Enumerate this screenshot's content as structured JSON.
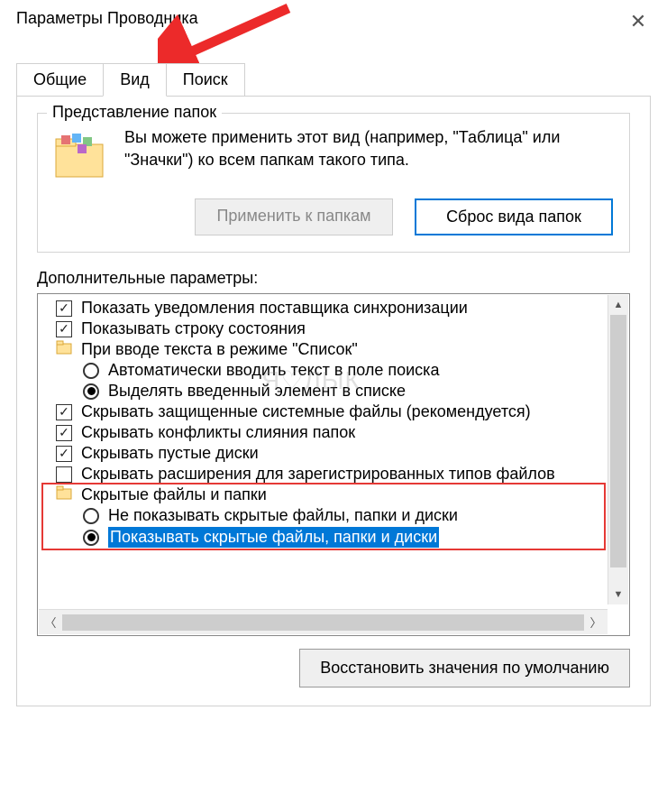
{
  "window": {
    "title": "Параметры Проводника",
    "close_symbol": "✕"
  },
  "tabs": {
    "general": "Общие",
    "view": "Вид",
    "search": "Поиск"
  },
  "folderViews": {
    "legend": "Представление папок",
    "description": "Вы можете применить этот вид (например, \"Таблица\" или \"Значки\") ко всем папкам такого типа.",
    "applyBtn": "Применить к папкам",
    "resetBtn": "Сброс вида папок"
  },
  "advanced": {
    "label": "Дополнительные параметры:",
    "items": [
      {
        "type": "check",
        "checked": true,
        "level": 1,
        "text": "Показать уведомления поставщика синхронизации"
      },
      {
        "type": "check",
        "checked": true,
        "level": 1,
        "text": "Показывать строку состояния"
      },
      {
        "type": "group",
        "level": 1,
        "text": "При вводе текста в режиме \"Список\""
      },
      {
        "type": "radio",
        "checked": false,
        "level": 2,
        "text": "Автоматически вводить текст в поле поиска"
      },
      {
        "type": "radio",
        "checked": true,
        "level": 2,
        "text": "Выделять введенный элемент в списке"
      },
      {
        "type": "check",
        "checked": true,
        "level": 1,
        "text": "Скрывать защищенные системные файлы (рекомендуется)"
      },
      {
        "type": "check",
        "checked": true,
        "level": 1,
        "text": "Скрывать конфликты слияния папок"
      },
      {
        "type": "check",
        "checked": true,
        "level": 1,
        "text": "Скрывать пустые диски"
      },
      {
        "type": "check",
        "checked": false,
        "level": 1,
        "text": "Скрывать расширения для зарегистрированных типов файлов"
      },
      {
        "type": "group",
        "level": 1,
        "text": "Скрытые файлы и папки"
      },
      {
        "type": "radio",
        "checked": false,
        "level": 2,
        "text": "Не показывать скрытые файлы, папки и диски"
      },
      {
        "type": "radio",
        "checked": true,
        "level": 2,
        "text": "Показывать скрытые файлы, папки и диски",
        "selected": true
      }
    ]
  },
  "restoreBtn": "Восстановить значения по умолчанию",
  "watermark": "Я♡ЛЫК",
  "colors": {
    "accent": "#0078d7",
    "highlight": "#e53935",
    "arrow": "#ec2a2a"
  }
}
